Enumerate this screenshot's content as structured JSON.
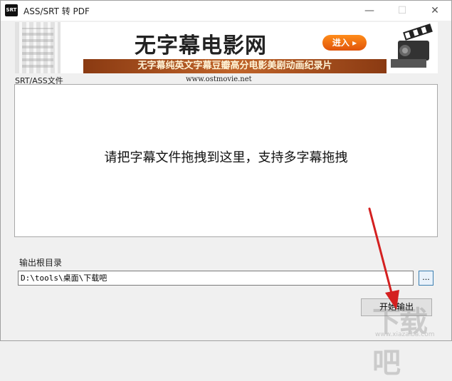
{
  "window": {
    "title": "ASS/SRT 转 PDF",
    "icon_text": "SRT",
    "minimize": "—",
    "maximize": "☐",
    "close": "✕"
  },
  "banner": {
    "title": "无字幕电影网",
    "enter_label": "进入 ▸",
    "subtitle": "无字幕纯英文字幕豆瓣高分电影美剧动画纪录片"
  },
  "srt_group": {
    "label": "SRT/ASS文件",
    "site_url": "www.ostmovie.net",
    "drop_hint": "请把字幕文件拖拽到这里，支持多字幕拖拽"
  },
  "output": {
    "label": "输出根目录",
    "path_value": "D:\\tools\\桌面\\下载吧",
    "browse_label": "...",
    "start_label": "开始输出"
  },
  "watermark": {
    "logo": "下载吧",
    "url": "www.xiazaiba.com"
  },
  "colors": {
    "arrow": "#d42020",
    "enter_button": "#f07a14"
  }
}
